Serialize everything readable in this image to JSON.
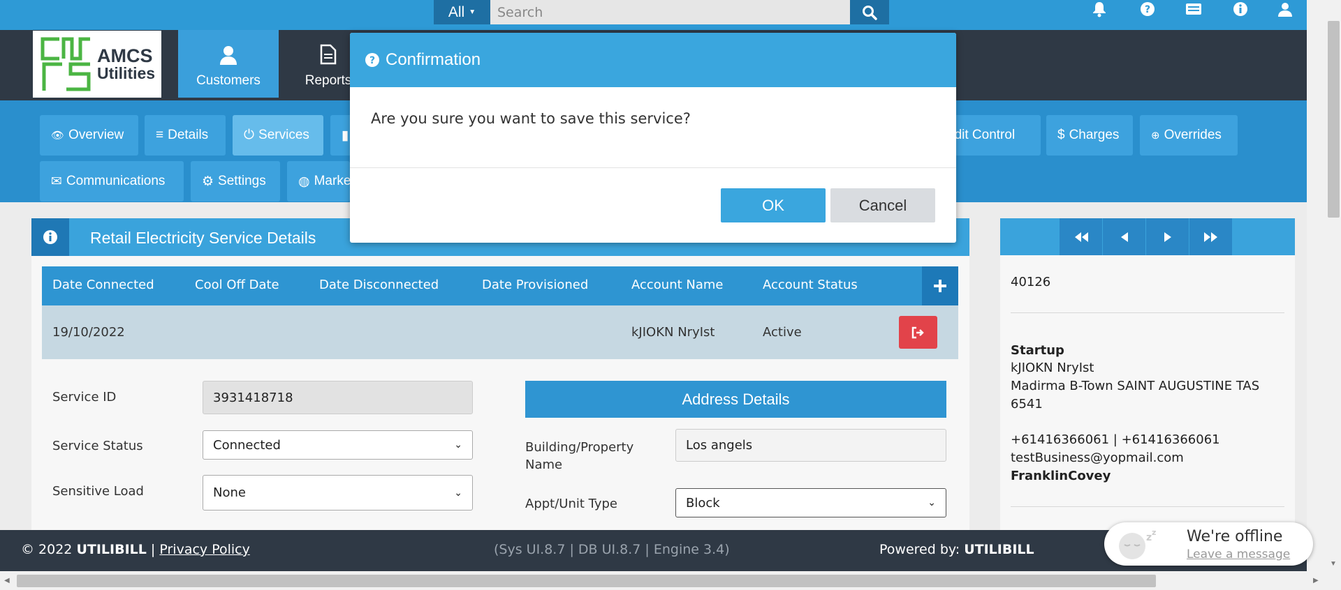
{
  "search": {
    "scope": "All",
    "placeholder": "Search"
  },
  "logo": {
    "text_line1": "AMCS",
    "text_line2": "Utilities"
  },
  "nav": {
    "customers": "Customers",
    "reports": "Reports"
  },
  "tabs": {
    "overview": "Overview",
    "details": "Details",
    "services": "Services",
    "credit_control": "edit Control",
    "charges": "Charges",
    "overrides": "Overrides",
    "communications": "Communications",
    "settings": "Settings",
    "market": "Marke"
  },
  "panel": {
    "title": "Retail Electricity Service Details"
  },
  "table": {
    "headers": [
      "Date Connected",
      "Cool Off Date",
      "Date Disconnected",
      "Date Provisioned",
      "Account Name",
      "Account Status"
    ],
    "row": {
      "date_connected": "19/10/2022",
      "account_name": "kJIOKN NryIst",
      "account_status": "Active"
    }
  },
  "form": {
    "service_id_label": "Service ID",
    "service_id_value": "3931418718",
    "service_status_label": "Service Status",
    "service_status_value": "Connected",
    "sensitive_load_label": "Sensitive Load",
    "sensitive_load_value": "None"
  },
  "address": {
    "title": "Address Details",
    "building_label_1": "Building/Property",
    "building_label_2": "Name",
    "building_value": "Los angels",
    "unit_type_label": "Appt/Unit Type",
    "unit_type_value": "Block"
  },
  "right_panel": {
    "id": "40126",
    "plan": "Startup",
    "name": "kJIOKN NryIst",
    "address_line1": "Madirma B-Town SAINT AUGUSTINE TAS",
    "address_line2": "6541",
    "phones": "+61416366061 | +61416366061",
    "email": "testBusiness@yopmail.com",
    "company": "FranklinCovey"
  },
  "footer": {
    "copyright_prefix": "© 2022",
    "brand": "UTILIBILL",
    "separator": "|",
    "privacy": "Privacy Policy",
    "versions": "(Sys UI.8.7 | DB UI.8.7 | Engine 3.4)",
    "powered_prefix": "Powered by:",
    "powered_brand": "UTILIBILL"
  },
  "chat": {
    "status": "We're offline",
    "link": "Leave a message"
  },
  "modal": {
    "title": "Confirmation",
    "message": "Are you sure you want to save this service?",
    "ok": "OK",
    "cancel": "Cancel"
  },
  "colors": {
    "primary": "#3aa6de",
    "header_dark": "#2f3945",
    "danger": "#e2434a"
  },
  "icons": [
    "search-icon",
    "bell-icon",
    "question-icon",
    "card-icon",
    "info-icon",
    "user-icon",
    "eye-icon",
    "list-icon",
    "power-icon",
    "dollar-icon",
    "arrow-circle-icon",
    "envelope-icon",
    "gear-icon",
    "globe-icon",
    "plus-icon",
    "sign-out-icon",
    "fast-backward-icon",
    "backward-icon",
    "forward-icon",
    "fast-forward-icon",
    "sleeping-face-icon"
  ]
}
